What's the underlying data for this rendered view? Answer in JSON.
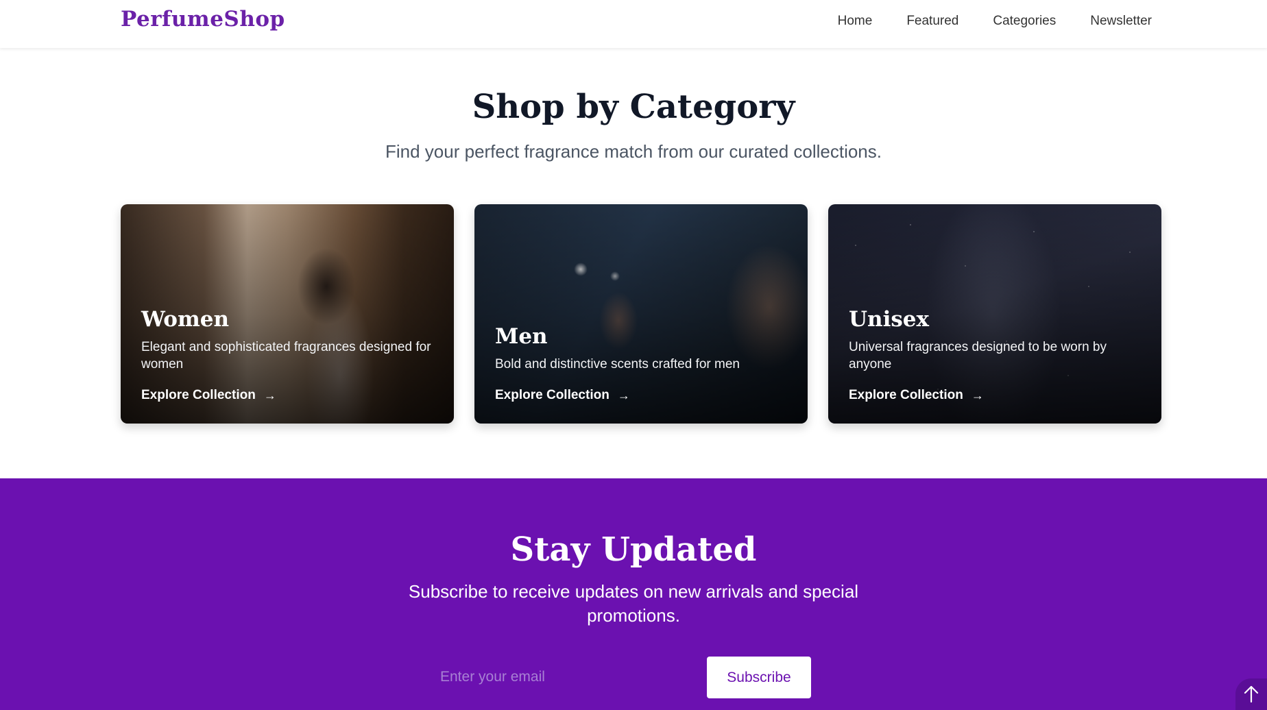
{
  "header": {
    "logo": "PerfumeShop",
    "nav": [
      "Home",
      "Featured",
      "Categories",
      "Newsletter"
    ]
  },
  "categories": {
    "title": "Shop by Category",
    "subtitle": "Find your perfect fragrance match from our curated collections.",
    "cards": [
      {
        "title": "Women",
        "description": "Elegant and sophisticated fragrances designed for women",
        "link": "Explore Collection"
      },
      {
        "title": "Men",
        "description": "Bold and distinctive scents crafted for men",
        "link": "Explore Collection"
      },
      {
        "title": "Unisex",
        "description": "Universal fragrances designed to be worn by anyone",
        "link": "Explore Collection"
      }
    ]
  },
  "newsletter": {
    "title": "Stay Updated",
    "subtitle": "Subscribe to receive updates on new arrivals and special promotions.",
    "email_placeholder": "Enter your email",
    "button": "Subscribe"
  },
  "icons": {
    "link_arrow": "arrow-right-icon",
    "scroll_top": "arrow-up-icon"
  },
  "colors": {
    "brand": "#6b21a8",
    "newsletter_bg": "#6b11b0",
    "button_text": "#6b11b0"
  }
}
